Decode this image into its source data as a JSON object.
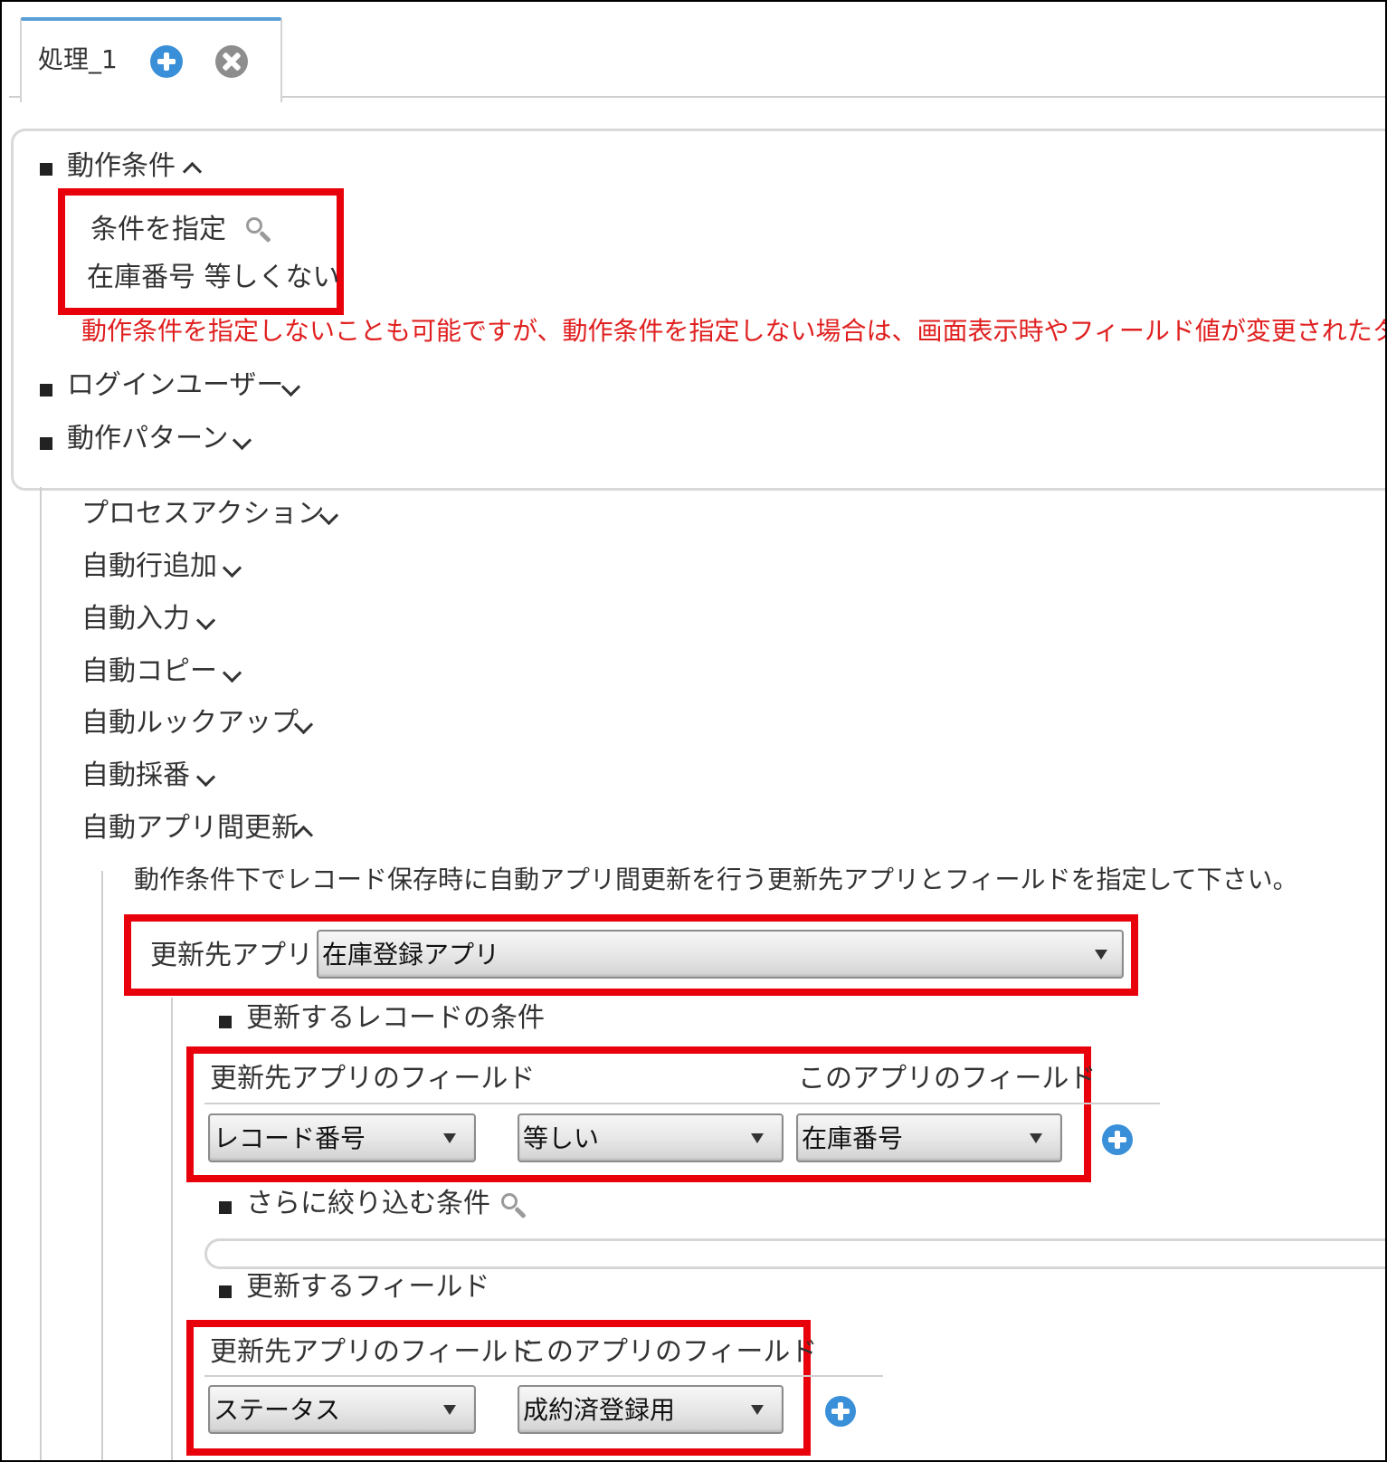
{
  "tab": {
    "label": "処理_1"
  },
  "sections": {
    "conditions": {
      "title": "動作条件"
    },
    "condition_spec": {
      "label": "条件を指定",
      "value": "在庫番号 等しくない"
    },
    "warning": "動作条件を指定しないことも可能ですが、動作条件を指定しない場合は、画面表示時やフィールド値が変更されたタイ",
    "login_user": {
      "title": "ログインユーザー"
    },
    "pattern": {
      "title": "動作パターン"
    }
  },
  "actions": [
    {
      "label": "プロセスアクション"
    },
    {
      "label": "自動行追加"
    },
    {
      "label": "自動入力"
    },
    {
      "label": "自動コピー"
    },
    {
      "label": "自動ルックアップ"
    },
    {
      "label": "自動採番"
    },
    {
      "label": "自動アプリ間更新"
    }
  ],
  "auto_update": {
    "description": "動作条件下でレコード保存時に自動アプリ間更新を行う更新先アプリとフィールドを指定して下さい。",
    "target_app_label": "更新先アプリ",
    "target_app_value": "在庫登録アプリ",
    "record_condition_title": "更新するレコードの条件",
    "cond_header_left": "更新先アプリのフィールド",
    "cond_header_right": "このアプリのフィールド",
    "cond_field": "レコード番号",
    "cond_operator": "等しい",
    "cond_this_field": "在庫番号",
    "narrow_title": "さらに絞り込む条件",
    "update_fields_title": "更新するフィールド",
    "upd_header_left": "更新先アプリのフィールド",
    "upd_header_right": "このアプリのフィールド",
    "upd_field": "ステータス",
    "upd_this_field": "成約済登録用"
  },
  "colors": {
    "accent_blue": "#3a8fd9",
    "highlight_red": "#e8000b",
    "warning_red": "#e02020"
  }
}
